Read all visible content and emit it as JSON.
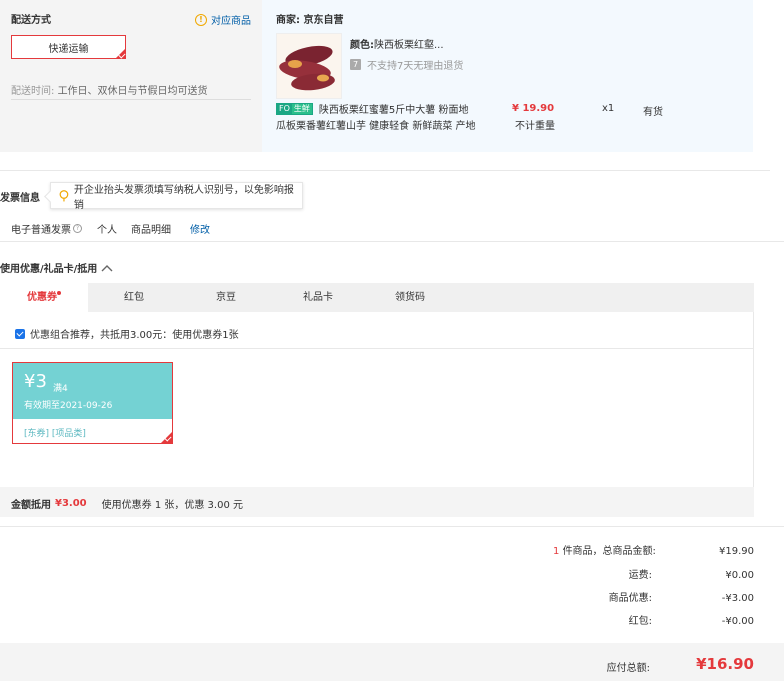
{
  "delivery": {
    "title": "配送方式",
    "matched_goods_link": "对应商品",
    "method": "快递运输",
    "time_label": "配送时间:",
    "time_value": "工作日、双休日与节假日均可送货"
  },
  "goods": {
    "seller_label": "商家:",
    "seller_name": "京东自营",
    "color_label": "颜色:",
    "color_value": "陕西板栗红壑...",
    "return_policy": "不支持7天无理由退货",
    "fresh_tag_icon": "FO",
    "fresh_tag_text": "生鲜",
    "name_line1": "陕西板栗红蜜薯5斤中大薯 粉面地",
    "name_line2": "瓜板栗番薯红薯山芋 健康轻食 新鲜蔬菜 产地",
    "price": "¥ 19.90",
    "weight_note": "不计重量",
    "quantity": "x1",
    "stock": "有货"
  },
  "invoice": {
    "title": "发票信息",
    "tip": "开企业抬头发票须填写纳税人识别号，以免影响报销",
    "type": "电子普通发票",
    "recipient": "个人",
    "content": "商品明细",
    "edit": "修改"
  },
  "discount": {
    "title": "使用优惠/礼品卡/抵用",
    "tabs": [
      "优惠券",
      "红包",
      "京豆",
      "礼品卡",
      "领货码"
    ],
    "recommend": "优惠组合推荐，共抵用3.00元：使用优惠券1张",
    "coupon": {
      "amount": "¥3",
      "condition": "满4",
      "expiry": "有效期至2021-09-26",
      "tags": "[东券] [项品类]"
    },
    "deduct_label": "金额抵用",
    "deduct_value": "¥3.00",
    "deduct_summary": "使用优惠券 1 张，优惠 3.00 元"
  },
  "summary": {
    "count": "1",
    "count_suffix": "件商品，总商品金额:",
    "goods_amount": "¥19.90",
    "freight_label": "运费:",
    "freight": "¥0.00",
    "discount_label": "商品优惠:",
    "discount": "-¥3.00",
    "redpacket_label": "红包:",
    "redpacket": "-¥0.00",
    "total_label": "应付总额:",
    "total": "¥16.90"
  },
  "colors": {
    "accent_red": "#e4393c",
    "coupon_teal": "#74d2d3",
    "link_blue": "#005ea7"
  }
}
